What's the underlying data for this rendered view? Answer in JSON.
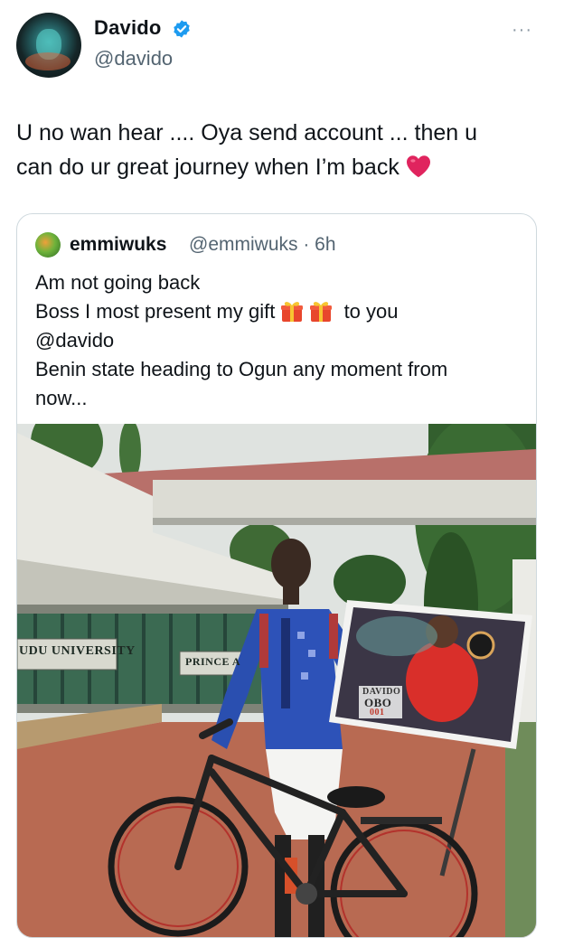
{
  "author": {
    "name": "Davido",
    "handle": "@davido",
    "more_label": "···"
  },
  "tweet": {
    "line1": "U no wan hear .... Oya send account ... then u",
    "line2": "can do ur great journey when I’m back"
  },
  "quoted": {
    "name": "emmiwuks",
    "handle": "@emmiwuks",
    "time": "· 6h",
    "line1": "Am not going back",
    "line2_pre": "Boss I most present my gift",
    "line2_post": "to you",
    "line3": "@davido",
    "line4": "Benin state heading to Ogun  any moment from",
    "line5": "now..."
  },
  "photo_signs": {
    "left": "UDU UNIVERSITY",
    "middle": "PRINCE A",
    "banner_top": "DAVIDO",
    "banner_num": "OBO",
    "banner_sub": "001"
  },
  "colors": {
    "verified": "#1d9bf0",
    "handle": "#536471",
    "heart": "#e0245e",
    "border": "#cfd9de"
  },
  "icons": [
    "verified-badge-icon",
    "more-options-icon",
    "red-heart-emoji",
    "gift-emoji"
  ]
}
